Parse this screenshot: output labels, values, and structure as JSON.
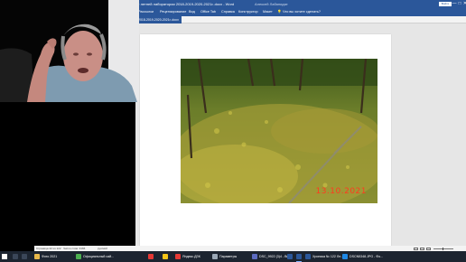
{
  "word": {
    "title": "ие летней лаборатории 2018-2019-2020-2021г..docx  -  Word",
    "user": "Алексей Лабанидзе",
    "signin_label": "Войти",
    "window_controls": [
      "—",
      "□",
      "✕"
    ],
    "ribbon_tabs": [
      "Рассылки",
      "Рецензирование",
      "Вид",
      "Office Tab",
      "Справка",
      "Конструктор",
      "Макет",
      "Что вы хотите сделать?"
    ],
    "active_tab": "Конструктор",
    "help_icon": "lightbulb-icon",
    "document_tab": "2018-2019-2020-2021г..docx",
    "photo": {
      "date_stamp": "13.10.2021"
    }
  },
  "statusbar": {
    "page_info": "Страница 42 из 122",
    "words": "Число слов: 3166",
    "language": "русский",
    "zoom_fraction": 0.45
  },
  "taskbar": {
    "items": [
      {
        "label": "Фото 2021",
        "icon": "folder-icon",
        "color": "#e8b84a"
      },
      {
        "label": "Официальный сай...",
        "icon": "chrome-icon",
        "color": "#4caf50"
      },
      {
        "label": "",
        "icon": "opera-icon",
        "color": "#e53935"
      },
      {
        "label": "",
        "icon": "yandex-icon",
        "color": "#f5c518"
      },
      {
        "label": "Яндекс.ДЗК",
        "icon": "yandex-browser-icon",
        "color": "#e53935"
      },
      {
        "label": "Параметры",
        "icon": "gear-icon",
        "color": "#9aa7b5"
      },
      {
        "label": "DSC_9922 (3)4 - Вк...",
        "icon": "camera-icon",
        "color": "#5c6bc0"
      },
      {
        "label": "",
        "icon": "word-icon",
        "color": "#2b579a"
      },
      {
        "label": "",
        "icon": "word-icon",
        "color": "#2b579a"
      },
      {
        "label": "Хроника № 122 Ле...",
        "icon": "word-icon",
        "color": "#2b579a"
      },
      {
        "label": "DSCN5348.JPG - Фо...",
        "icon": "photos-icon",
        "color": "#1e88e5"
      }
    ]
  }
}
